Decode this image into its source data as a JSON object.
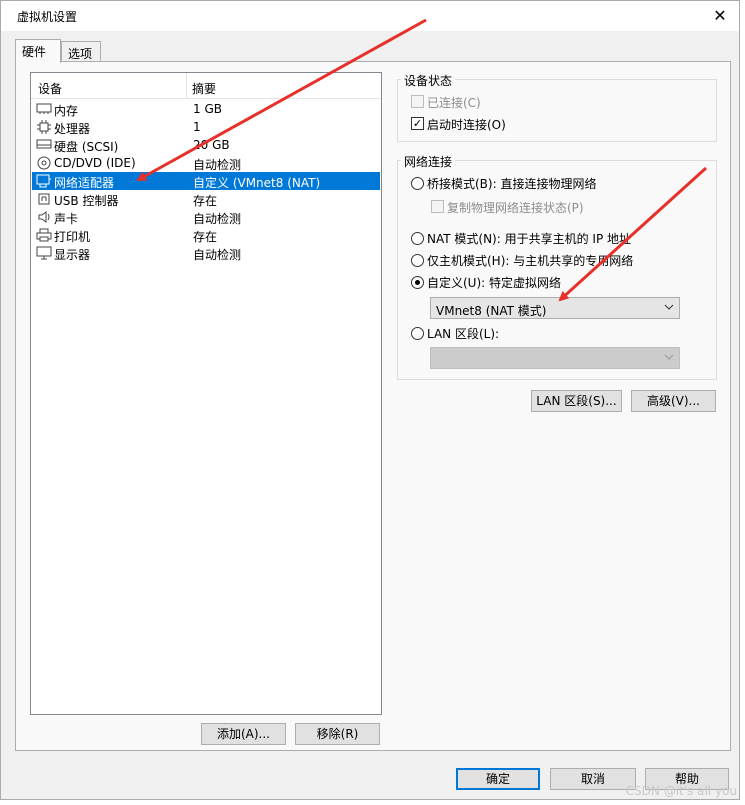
{
  "window": {
    "title": "虚拟机设置",
    "close_icon": "close-icon"
  },
  "tabs": [
    {
      "label": "硬件"
    },
    {
      "label": "选项"
    }
  ],
  "devices": {
    "headers": {
      "device": "设备",
      "summary": "摘要"
    },
    "items": [
      {
        "icon": "memory-icon",
        "name": "内存",
        "summary": "1 GB"
      },
      {
        "icon": "cpu-icon",
        "name": "处理器",
        "summary": "1"
      },
      {
        "icon": "harddisk-icon",
        "name": "硬盘 (SCSI)",
        "summary": "20 GB"
      },
      {
        "icon": "cdrom-icon",
        "name": "CD/DVD (IDE)",
        "summary": "自动检测"
      },
      {
        "icon": "network-adapter-icon",
        "name": "网络适配器",
        "summary": "自定义 (VMnet8 (NAT)",
        "selected": true
      },
      {
        "icon": "usb-icon",
        "name": "USB 控制器",
        "summary": "存在"
      },
      {
        "icon": "speaker-icon",
        "name": "声卡",
        "summary": "自动检测"
      },
      {
        "icon": "printer-icon",
        "name": "打印机",
        "summary": "存在"
      },
      {
        "icon": "monitor-icon",
        "name": "显示器",
        "summary": "自动检测"
      }
    ],
    "add_label": "添加(A)...",
    "remove_label": "移除(R)"
  },
  "device_status": {
    "title": "设备状态",
    "connected": {
      "label": "已连接(C)",
      "checked": false,
      "disabled": true
    },
    "connect_at_power_on": {
      "label": "启动时连接(O)",
      "checked": true
    }
  },
  "network": {
    "title": "网络连接",
    "bridged": {
      "label": "桥接模式(B): 直接连接物理网络",
      "checked": false
    },
    "replicate": {
      "label": "复制物理网络连接状态(P)",
      "checked": false,
      "disabled": true
    },
    "nat": {
      "label": "NAT 模式(N): 用于共享主机的 IP 地址",
      "checked": false
    },
    "host_only": {
      "label": "仅主机模式(H): 与主机共享的专用网络",
      "checked": false
    },
    "custom": {
      "label": "自定义(U): 特定虚拟网络",
      "checked": true
    },
    "custom_select": "VMnet8 (NAT 模式)",
    "lan": {
      "label": "LAN 区段(L):",
      "checked": false
    },
    "lan_select": "",
    "lan_segments_button": "LAN 区段(S)...",
    "advanced_button": "高级(V)..."
  },
  "footer": {
    "ok": "确定",
    "cancel": "取消",
    "help": "帮助"
  },
  "watermark": "CSDN @it's all you",
  "annotations": {
    "arrow_color": "#e8302a"
  },
  "colors": {
    "selection": "#0078d7",
    "default_button_border": "#0078d7"
  }
}
